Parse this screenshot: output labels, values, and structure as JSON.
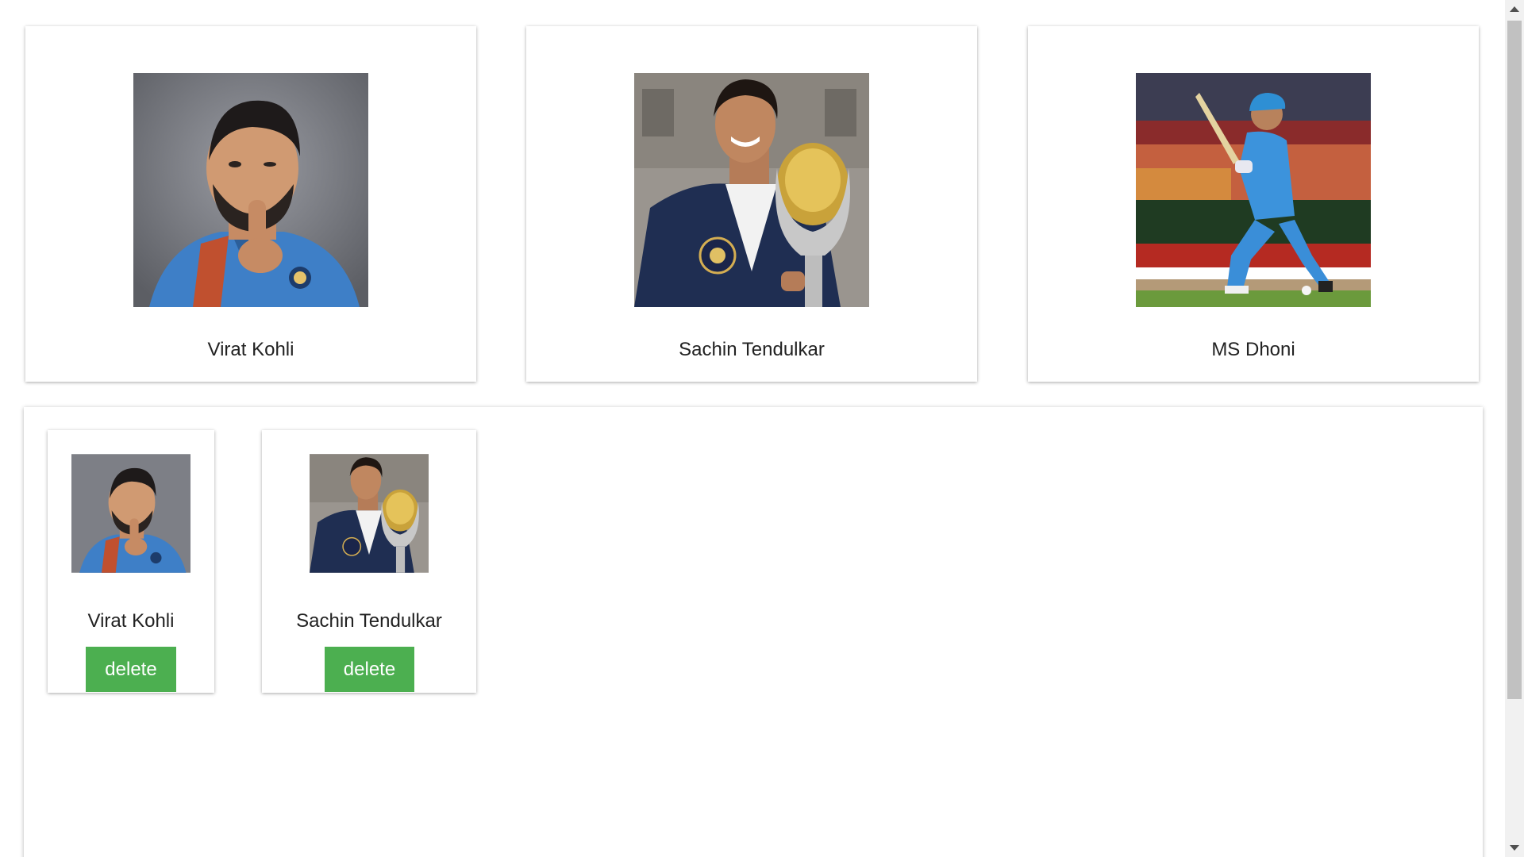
{
  "players": [
    {
      "name": "Virat Kohli",
      "photo": "virat-kohli-photo"
    },
    {
      "name": "Sachin Tendulkar",
      "photo": "sachin-tendulkar-photo"
    },
    {
      "name": "MS Dhoni",
      "photo": "ms-dhoni-photo"
    }
  ],
  "selected": [
    {
      "name": "Virat Kohli",
      "delete_label": "delete"
    },
    {
      "name": "Sachin Tendulkar",
      "delete_label": "delete"
    }
  ],
  "colors": {
    "button": "#4caf50",
    "jersey": "#3a8fd8",
    "blazer": "#1f2e52"
  }
}
